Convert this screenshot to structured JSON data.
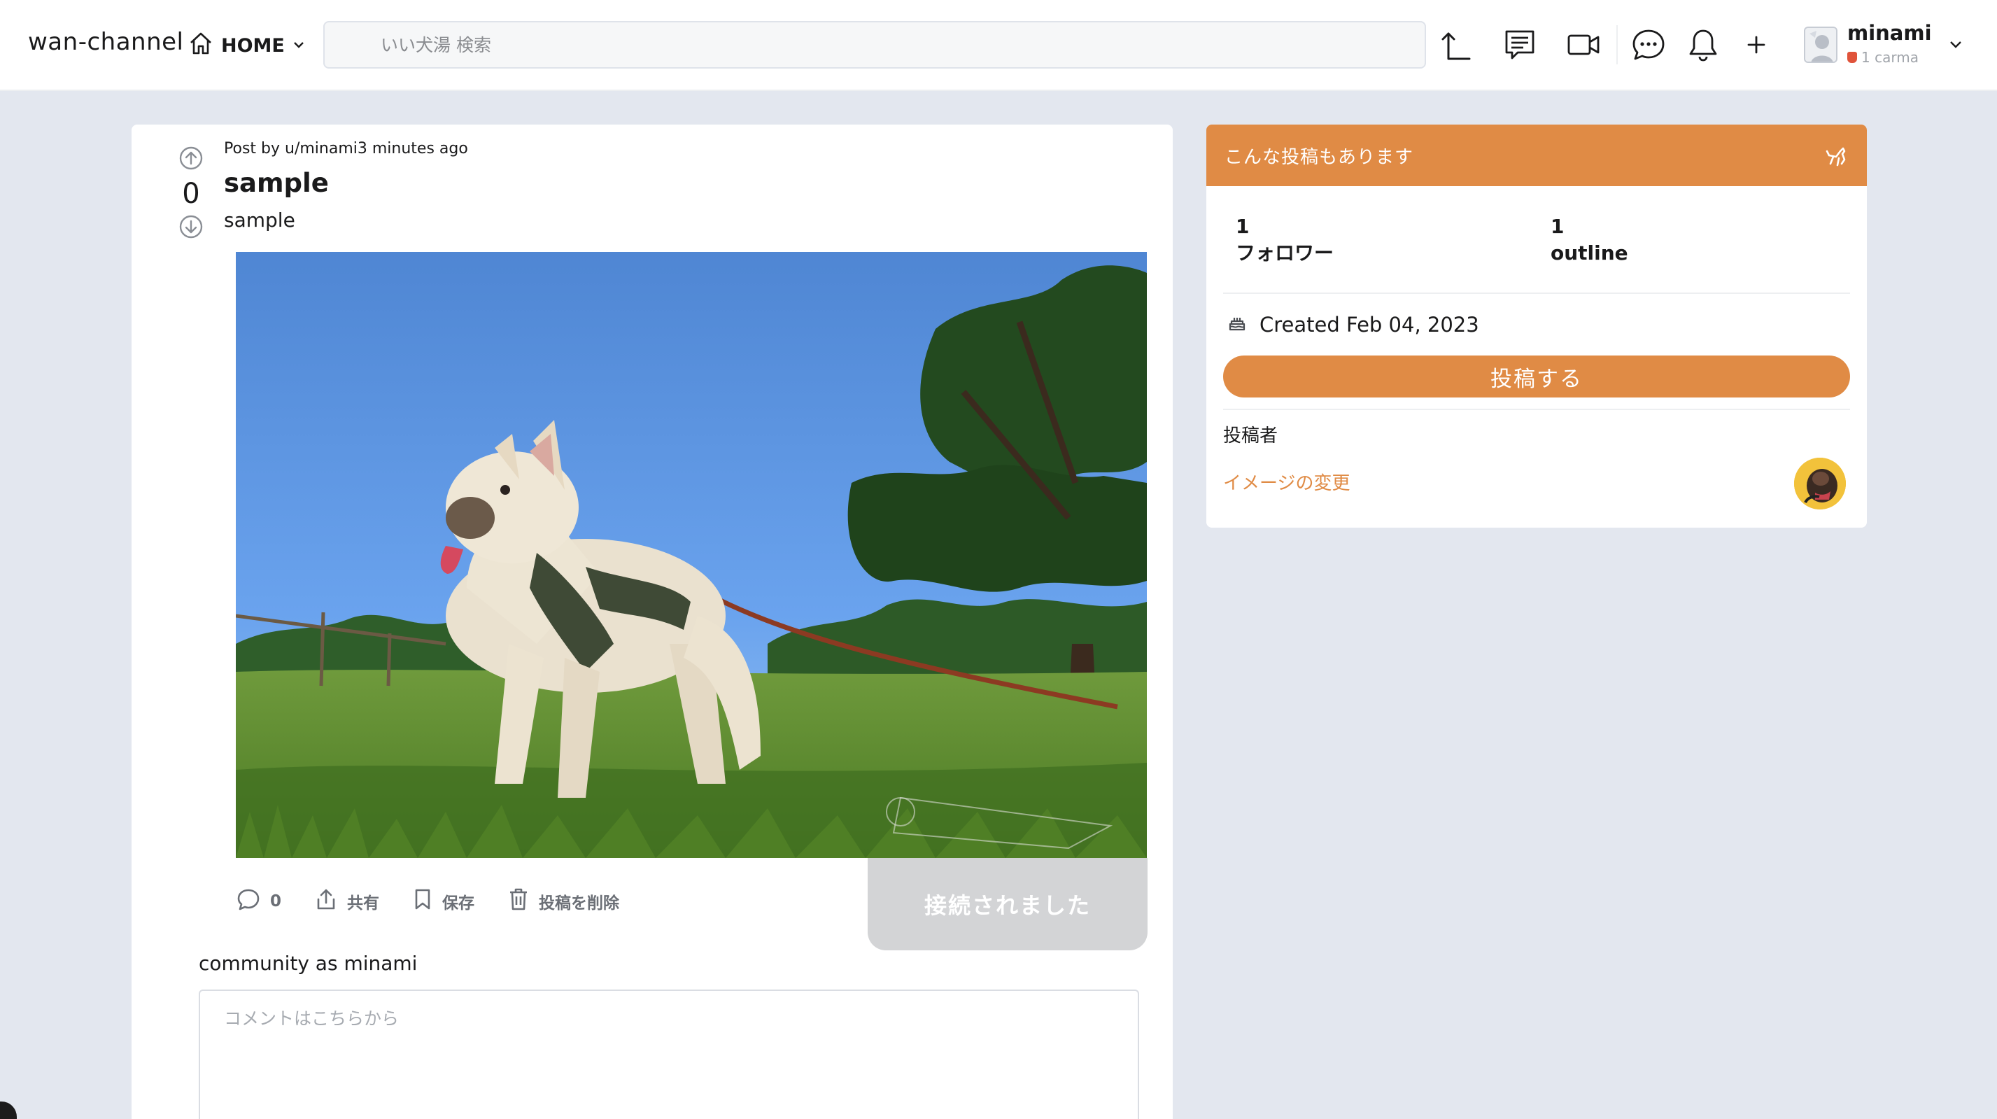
{
  "header": {
    "brand": "wan-channel",
    "home_label": "HOME",
    "search_placeholder": "いい犬湯 検索",
    "user": {
      "name": "minami",
      "karma": "1 carma"
    }
  },
  "post": {
    "votes": "0",
    "meta": "Post by u/minami3 minutes ago",
    "title": "sample",
    "body": "sample",
    "actions": {
      "comments_count": "0",
      "share": "共有",
      "save": "保存",
      "delete": "投稿を削除"
    },
    "connected_toast": "接続されました",
    "comment_as": "community as minami",
    "comment_placeholder": "コメントはこちらから"
  },
  "sidebar": {
    "header_title": "こんな投稿もあります",
    "stats": [
      {
        "value": "1",
        "label": "フォロワー"
      },
      {
        "value": "1",
        "label": "outline"
      }
    ],
    "created": "Created Feb 04, 2023",
    "post_button": "投稿する",
    "poster_label": "投稿者",
    "change_image": "イメージの変更"
  },
  "colors": {
    "accent": "#e08b45",
    "background": "#e3e7ef",
    "card": "#ffffff"
  }
}
